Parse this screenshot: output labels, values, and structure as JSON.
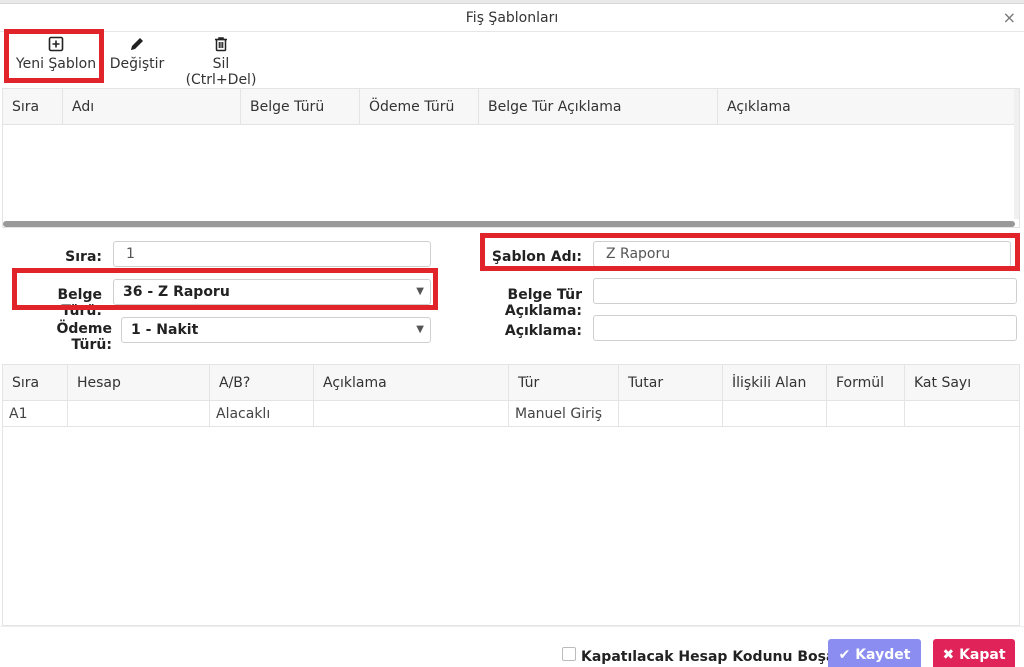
{
  "window": {
    "title": "Fiş Şablonları",
    "close": "×"
  },
  "toolbar": {
    "new_label": "Yeni Şablon",
    "edit_label": "Değiştir",
    "delete_label": "Sil (Ctrl+Del)"
  },
  "template_grid": {
    "columns": [
      "Sıra",
      "Adı",
      "Belge Türü",
      "Ödeme Türü",
      "Belge Tür Açıklama",
      "Açıklama"
    ]
  },
  "form": {
    "sira_label": "Sıra:",
    "sira_value": "1",
    "belge_turu_label": "Belge Türü:",
    "belge_turu_value": "36 - Z Raporu",
    "odeme_turu_label": "Ödeme Türü:",
    "odeme_turu_value": "1 - Nakit",
    "sablon_adi_label": "Şablon Adı:",
    "sablon_adi_value": "Z Raporu",
    "belge_tur_aciklama_label": "Belge Tür Açıklama:",
    "belge_tur_aciklama_value": "",
    "aciklama_label": "Açıklama:",
    "aciklama_value": ""
  },
  "detail_grid": {
    "columns": [
      "Sıra",
      "Hesap",
      "A/B?",
      "Açıklama",
      "Tür",
      "Tutar",
      "İlişkili Alan",
      "Formül",
      "Kat Sayı"
    ],
    "rows": [
      [
        "A1",
        "",
        "Alacaklı",
        "",
        "Manuel Giriş",
        "",
        "",
        "",
        ""
      ]
    ]
  },
  "footer": {
    "checkbox_label": "Kapatılacak Hesap Kodunu Boşalt",
    "save_label": "Kaydet",
    "close_label": "Kapat"
  },
  "colors": {
    "highlight": "#e0242a",
    "save": "#8b8ef0",
    "close": "#e0245a"
  }
}
